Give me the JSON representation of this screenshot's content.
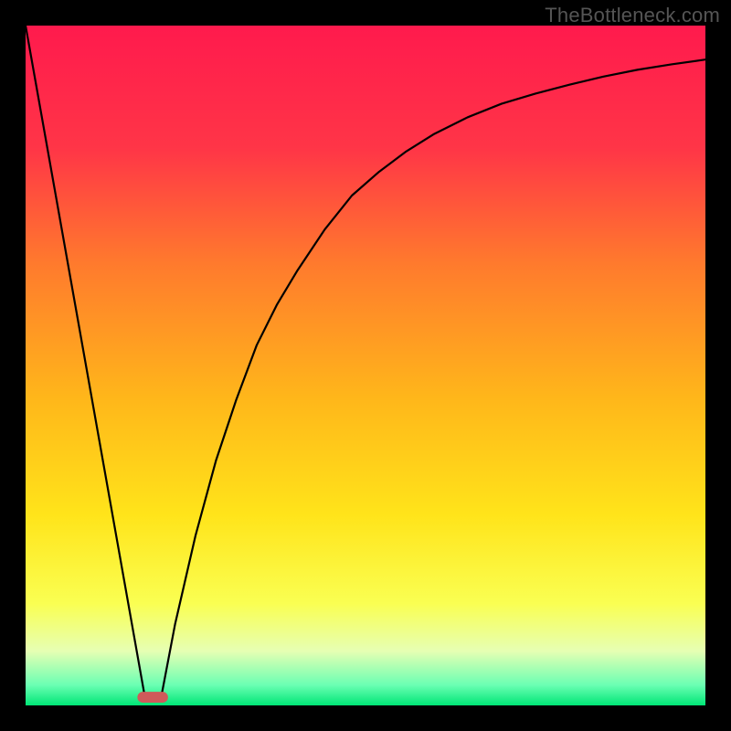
{
  "watermark": "TheBottleneck.com",
  "chart_data": {
    "type": "line",
    "title": "",
    "xlabel": "",
    "ylabel": "",
    "xlim": [
      0,
      100
    ],
    "ylim": [
      0,
      100
    ],
    "series": [
      {
        "name": "left-line",
        "x": [
          0,
          17.5
        ],
        "y": [
          100,
          1.5
        ]
      },
      {
        "name": "right-curve",
        "x": [
          20.0,
          22,
          25,
          28,
          31,
          34,
          37,
          40,
          44,
          48,
          52,
          56,
          60,
          65,
          70,
          75,
          80,
          85,
          90,
          95,
          100
        ],
        "y": [
          1.5,
          12,
          25,
          36,
          45,
          53,
          59,
          64,
          70,
          75,
          78.5,
          81.5,
          84,
          86.5,
          88.5,
          90,
          91.3,
          92.5,
          93.5,
          94.3,
          95
        ]
      }
    ],
    "marker": {
      "x": 18.7,
      "y": 1.2,
      "color": "#cf5a5a",
      "width": 4.5,
      "height": 1.6
    },
    "gradient_stops": [
      {
        "offset": 0,
        "color": "#ff1a4d"
      },
      {
        "offset": 18,
        "color": "#ff3547"
      },
      {
        "offset": 35,
        "color": "#ff7a2d"
      },
      {
        "offset": 55,
        "color": "#ffb71a"
      },
      {
        "offset": 72,
        "color": "#ffe41a"
      },
      {
        "offset": 85,
        "color": "#faff52"
      },
      {
        "offset": 92,
        "color": "#e6ffb3"
      },
      {
        "offset": 97,
        "color": "#6bffb3"
      },
      {
        "offset": 100,
        "color": "#00e676"
      }
    ]
  }
}
